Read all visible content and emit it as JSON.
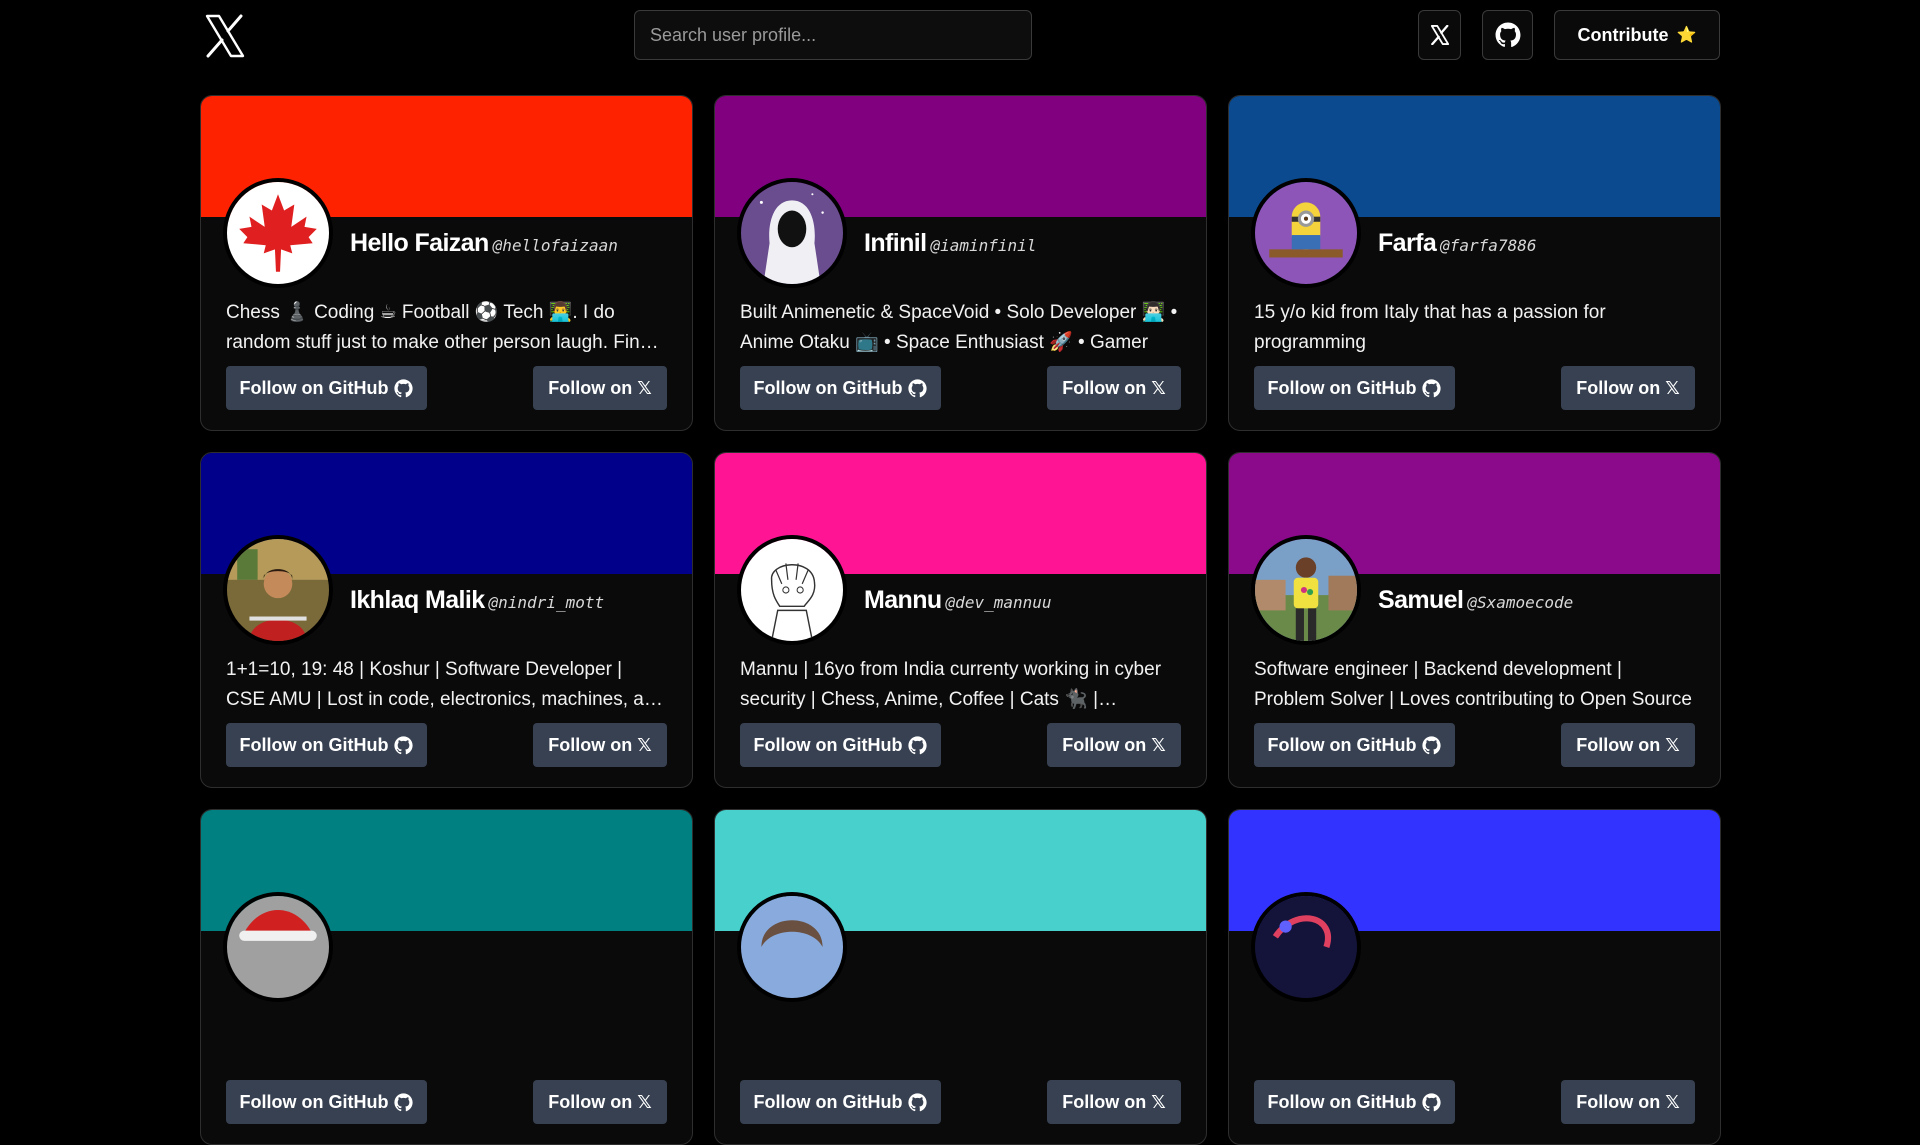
{
  "header": {
    "search_placeholder": "Search user profile...",
    "x_button_icon": "x-logo-icon",
    "github_button_icon": "github-icon",
    "contribute_label": "Contribute",
    "contribute_icon": "⭐"
  },
  "buttons": {
    "github_label": "Follow on GitHub",
    "x_label": "Follow on 𝕏"
  },
  "cards": [
    {
      "name": "Hello Faizan",
      "handle": "@hellofaizaan",
      "bio": "Chess ♟️ Coding ☕ Football ⚽ Tech 👨‍💻. I do random stuff just to make other person laugh. Find me => linktr.ee/hellofaizaan",
      "banner": "#ff2200",
      "avatar": "maple-leaf"
    },
    {
      "name": "Infinil",
      "handle": "@iaminfinil",
      "bio": "Built Animenetic & SpaceVoid • Solo Developer 👨🏻‍💻 • Anime Otaku 📺 • Space Enthusiast 🚀 • Gamer",
      "banner": "#800080",
      "avatar": "hooded-figure"
    },
    {
      "name": "Farfa",
      "handle": "@farfa7886",
      "bio": "15 y/o kid from Italy that has a passion for programming",
      "banner": "#0b4a8f",
      "avatar": "minion"
    },
    {
      "name": "Ikhlaq Malik",
      "handle": "@nindri_mott",
      "bio": "1+1=10, 19: 48 | Koshur | Software Developer | CSE AMU | Lost in code, electronics, machines, and the universe",
      "banner": "#00008b",
      "avatar": "person-photo"
    },
    {
      "name": "Mannu",
      "handle": "@dev_mannuu",
      "bio": "Mannu | 16yo from India currenty working in cyber security | Chess, Anime, Coffee | Cats 🐈‍⬛ | Developer",
      "banner": "#ff1493",
      "avatar": "anime-sketch"
    },
    {
      "name": "Samuel",
      "handle": "@Sxamoecode",
      "bio": "Software engineer | Backend development | Problem Solver | Loves contributing to Open Source",
      "banner": "#8b0a8b",
      "avatar": "person-standing"
    },
    {
      "name": "",
      "handle": "",
      "bio": "",
      "banner": "#008080",
      "avatar": "santa-hat"
    },
    {
      "name": "",
      "handle": "",
      "bio": "",
      "banner": "#48d1cc",
      "avatar": "anime-boy"
    },
    {
      "name": "",
      "handle": "",
      "bio": "",
      "banner": "#3333ff",
      "avatar": "space-art"
    }
  ]
}
